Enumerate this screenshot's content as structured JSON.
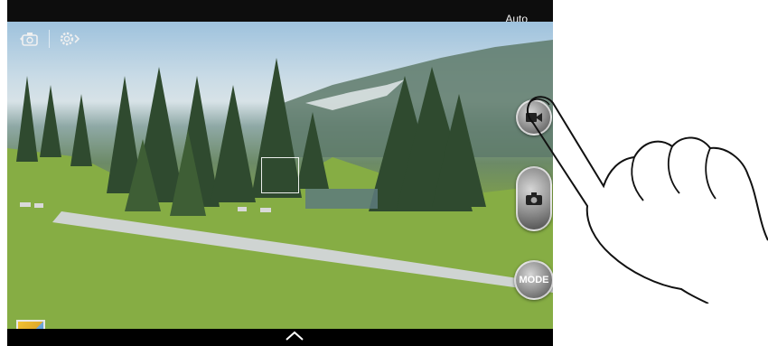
{
  "status_bar": {
    "mode_label": "Auto"
  },
  "controls": {
    "mode_button_label": "MODE"
  },
  "icons": {
    "self_camera": "switch-camera-icon",
    "settings": "settings-gear-icon",
    "record": "video-camera-icon",
    "shutter": "camera-icon",
    "gallery": "gallery-thumbnail",
    "expand": "chevron-up-icon",
    "gesture": "tap-hand-icon"
  }
}
